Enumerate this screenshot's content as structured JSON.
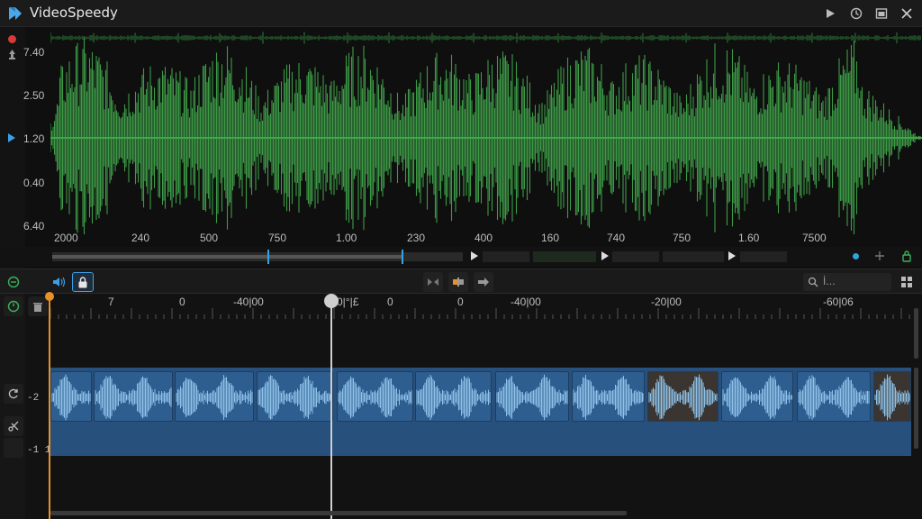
{
  "app": {
    "title": "VideoSpeedy"
  },
  "colors": {
    "accent": "#3aa0e8",
    "wave": "#3c9a46",
    "clip": "#2e5d8f",
    "inpoint": "#e8902a",
    "record": "#d83a3a"
  },
  "waveform": {
    "y_labels": [
      "7.40",
      "2.50",
      "1.20",
      "0.40",
      "6.40"
    ],
    "x_labels": [
      "2000",
      "240",
      "500",
      "750",
      "1.00",
      "230",
      "400",
      "160",
      "740",
      "750",
      "1.60",
      "7500"
    ]
  },
  "toolbar": {
    "search_placeholder": "İ..."
  },
  "timeline": {
    "ruler_labels": [
      "7",
      "0",
      "-40|00",
      "0|°|£",
      "0",
      "0",
      "-40|00",
      "-20|00",
      "-60|06"
    ],
    "track_labels": [
      "-2",
      "-1 1"
    ]
  },
  "icons": [
    "logo-icon",
    "play-icon",
    "history-icon",
    "window-icon",
    "close-icon",
    "record-icon",
    "pin-icon",
    "playhead-marker-icon",
    "volume-icon",
    "lock-icon",
    "trim-icon",
    "split-icon",
    "arrow-icon",
    "search-icon",
    "grid-icon",
    "clock-icon",
    "trash-icon",
    "sync-icon",
    "cut-icon"
  ]
}
